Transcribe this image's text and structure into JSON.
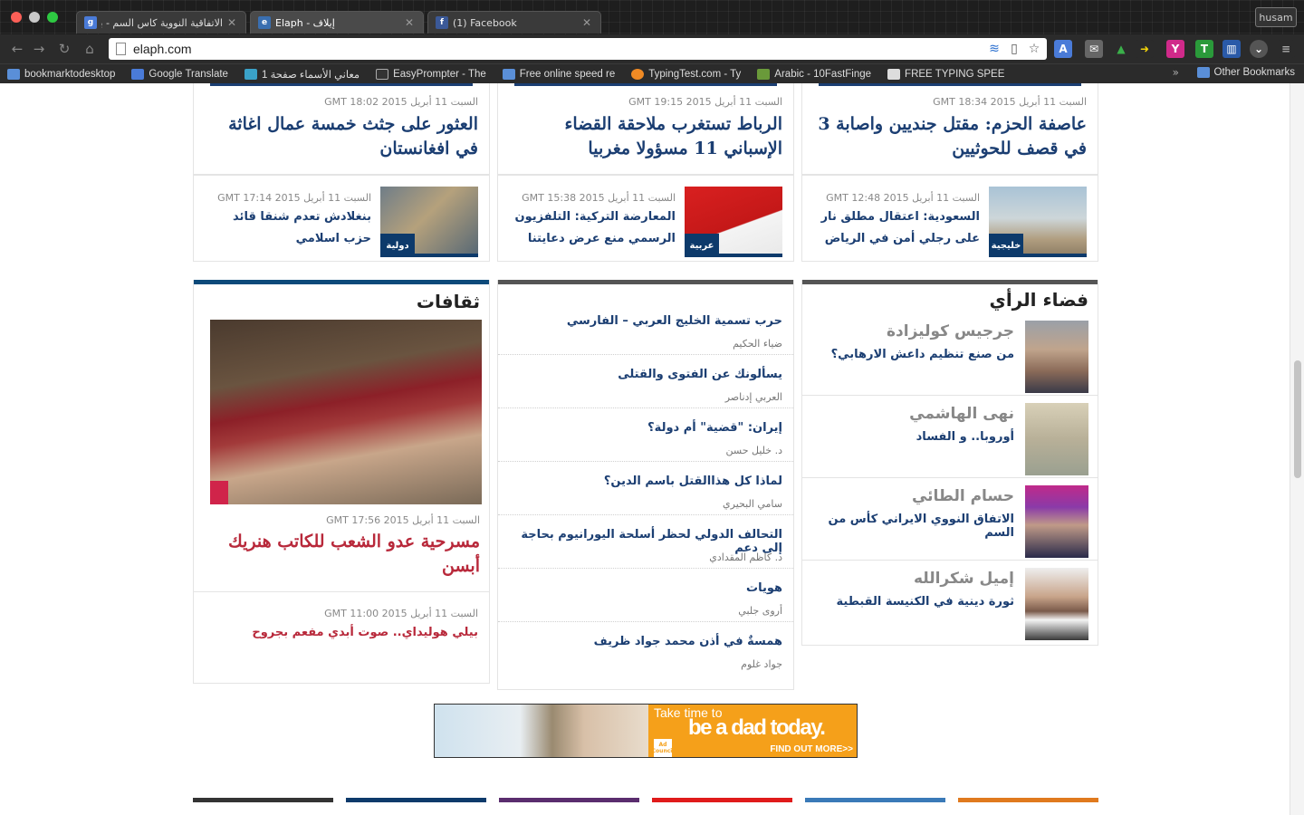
{
  "browser": {
    "tabs": [
      {
        "title": "الاتفاقية النووية كاس السم - بحث ..",
        "favicon_color": "#4a7bd8",
        "favicon_letter": "g",
        "active": false
      },
      {
        "title": "Elaph - إيلاف",
        "favicon_color": "#3a6fb0",
        "favicon_letter": "e",
        "active": true
      },
      {
        "title": "(1) Facebook",
        "favicon_color": "#3b5998",
        "favicon_letter": "f",
        "active": false
      }
    ],
    "user_label": "husam",
    "url": "elaph.com",
    "bookmarks": [
      {
        "label": "bookmarktodesktop",
        "color": "#5a8fd8"
      },
      {
        "label": "Google Translate",
        "color": "#4a7bd8"
      },
      {
        "label": "معاني الأسماء صفحة 1",
        "color": "#3aa2c8"
      },
      {
        "label": "EasyPrompter - The",
        "color": "#333333"
      },
      {
        "label": "Free online speed re",
        "color": "#5a8fd8"
      },
      {
        "label": "TypingTest.com - Ty",
        "color": "#f08a24"
      },
      {
        "label": "Arabic - 10FastFinge",
        "color": "#6a9a3a"
      },
      {
        "label": "FREE TYPING SPEE",
        "color": "#dddddd"
      }
    ],
    "other_bookmarks": "Other Bookmarks",
    "more_bookmarks": "»"
  },
  "top_row": [
    {
      "time": "السبت 11 أبريل 2015 18:02 GMT",
      "headline": "العثور على جثث خمسة عمال اغاثة في افغانستان"
    },
    {
      "time": "السبت 11 أبريل 2015 19:15 GMT",
      "headline": "الرباط تستغرب ملاحقة القضاء الإسباني 11 مسؤولا مغربيا"
    },
    {
      "time": "السبت 11 أبريل 2015 18:34 GMT",
      "headline": "عاصفة الحزم: مقتل جنديين واصابة 3 في قصف للحوثيين"
    }
  ],
  "thumb_row": [
    {
      "time": "السبت 11 أبريل 2015 17:14 GMT",
      "headline": "بنغلادش تعدم شنقا قائد حزب اسلامي",
      "badge": "دولية"
    },
    {
      "time": "السبت 11 أبريل 2015 15:38 GMT",
      "headline": "المعارضة التركية: التلفزيون الرسمي منع عرض دعايتنا",
      "badge": "عربية"
    },
    {
      "time": "السبت 11 أبريل 2015 12:48 GMT",
      "headline": "السعودية: اعتقال مطلق نار على رجلي أمن في الرياض",
      "badge": "خليجية"
    }
  ],
  "culture": {
    "title": "ثقافات",
    "main_time": "السبت 11 أبريل 2015 17:56 GMT",
    "main_headline": "مسرحية عدو الشعب للكاتب هنريك أبسن",
    "second_time": "السبت 11 أبريل 2015 11:00 GMT",
    "second_headline": "بيلي هوليداي.. صوت أبدي مفعم بجروح"
  },
  "articles": [
    {
      "title": "حرب تسمية الخليج العربي – الفارسي",
      "author": "ضياء الحكيم"
    },
    {
      "title": "يسألونك عن الفتوى والقتلى",
      "author": "العربي إدناصر"
    },
    {
      "title": "إيران: \"قضية\" أم دولة؟",
      "author": "د. خليل حسن"
    },
    {
      "title": "لماذا كل هذاالقتل باسم الدين؟",
      "author": "سامي البحيري"
    },
    {
      "title": "التحالف الدولي لحظر أسلحة اليورانيوم بحاجة إلى دعم",
      "author": "د. كاظم المقدادي"
    },
    {
      "title": "هويات",
      "author": "أروى جلبي"
    },
    {
      "title": "همسةٌ في أذن محمد جواد ظريف",
      "author": "جواد غلوم"
    }
  ],
  "opinion": {
    "title": "فضاء الرأي",
    "items": [
      {
        "author": "جرجيس كوليزادة",
        "title": "من صنع تنظيم داعش الارهابي؟"
      },
      {
        "author": "نهى الهاشمي",
        "title": "أوروبا.. و الفساد"
      },
      {
        "author": "حسام الطائي",
        "title": "الاتفاق النووي الايراني كأس من السم"
      },
      {
        "author": "إميل شكرالله",
        "title": "ثورة دينية في الكنيسة القبطية"
      }
    ]
  },
  "ad": {
    "line1": "Take time to",
    "line2": "be a dad today.",
    "cta": "FIND OUT MORE>>",
    "logo": "Ad Council"
  },
  "bottom_section_colors": [
    "#333333",
    "#0d3a6b",
    "#5a2d6e",
    "#e01b1b",
    "#3a7ab8",
    "#e07a1e"
  ]
}
